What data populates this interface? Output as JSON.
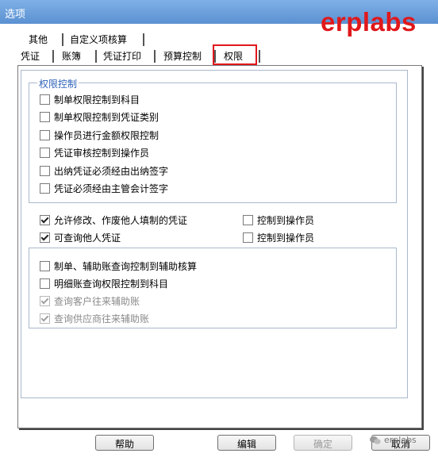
{
  "window": {
    "title": "选项"
  },
  "brand": {
    "text": "erplabs"
  },
  "tabs": {
    "row1": [
      {
        "label": "其他"
      },
      {
        "label": "自定义项核算"
      }
    ],
    "row2": [
      {
        "label": "凭证"
      },
      {
        "label": "账簿"
      },
      {
        "label": "凭证打印"
      },
      {
        "label": "预算控制"
      },
      {
        "label": "权限"
      }
    ],
    "active": "权限"
  },
  "permission_group": {
    "title": "权限控制",
    "items": [
      {
        "label": "制单权限控制到科目",
        "checked": false
      },
      {
        "label": "制单权限控制到凭证类别",
        "checked": false
      },
      {
        "label": "操作员进行金额权限控制",
        "checked": false
      },
      {
        "label": "凭证审核控制到操作员",
        "checked": false
      },
      {
        "label": "出纳凭证必须经由出纳签字",
        "checked": false
      },
      {
        "label": "凭证必须经由主管会计签字",
        "checked": false
      }
    ]
  },
  "options": [
    {
      "label": "允许修改、作废他人填制的凭证",
      "checked": true,
      "sub": {
        "label": "控制到操作员",
        "checked": false
      }
    },
    {
      "label": "可查询他人凭证",
      "checked": true,
      "sub": {
        "label": "控制到操作员",
        "checked": false
      }
    }
  ],
  "aux_group": {
    "items": [
      {
        "label": "制单、辅助账查询控制到辅助核算",
        "checked": false,
        "disabled": false
      },
      {
        "label": "明细账查询权限控制到科目",
        "checked": false,
        "disabled": false
      },
      {
        "label": "查询客户往来辅助账",
        "checked": true,
        "disabled": true
      },
      {
        "label": "查询供应商往来辅助账",
        "checked": true,
        "disabled": true
      }
    ]
  },
  "buttons": {
    "help": "帮助",
    "edit": "编辑",
    "ok": "确定",
    "cancel": "取消"
  },
  "watermark": {
    "text": "erplabs"
  },
  "colors": {
    "title_bar": "#6a9ed8",
    "brand": "#e0181b",
    "group_title": "#2f62b8"
  }
}
